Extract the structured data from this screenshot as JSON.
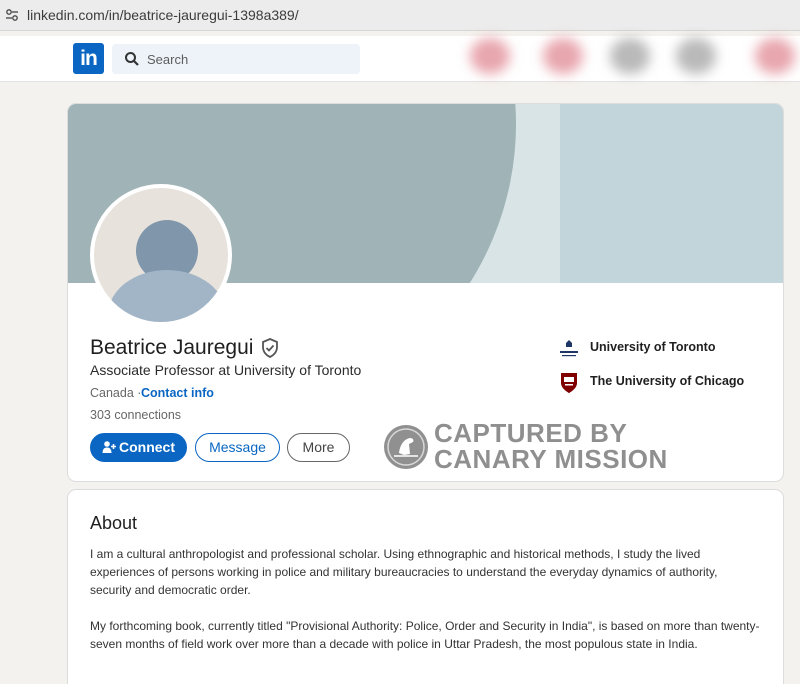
{
  "browser": {
    "url": "linkedin.com/in/beatrice-jauregui-1398a389/"
  },
  "nav": {
    "logo_text": "in",
    "search_placeholder": "Search"
  },
  "profile": {
    "name": "Beatrice Jauregui",
    "headline": "Associate Professor at University of Toronto",
    "location": "Canada",
    "separator": "·",
    "contact_info": "Contact info",
    "connections": "303 connections",
    "buttons": {
      "connect": "Connect",
      "message": "Message",
      "more": "More"
    },
    "education": [
      {
        "name": "University of Toronto",
        "logo": "university-of-toronto-logo"
      },
      {
        "name": "The University of Chicago",
        "logo": "university-of-chicago-logo"
      }
    ],
    "watermark": {
      "line1": "CAPTURED BY",
      "line2": "CANARY MISSION"
    }
  },
  "about": {
    "title": "About",
    "paragraphs": [
      "I am a cultural anthropologist and professional scholar. Using ethnographic and historical methods, I study the lived experiences of persons working in police and military bureaucracies to understand the everyday dynamics of authority, security and democratic order.",
      "My forthcoming book, currently titled \"Provisional Authority: Police, Order and Security in India\", is based on more than twenty-seven months of field work over more than a decade with police in Uttar Pradesh, the most populous state in India."
    ]
  },
  "colors": {
    "linkedin_blue": "#0a66c2",
    "banner": "#a0b4b8",
    "page_bg": "#f4f2ee"
  }
}
